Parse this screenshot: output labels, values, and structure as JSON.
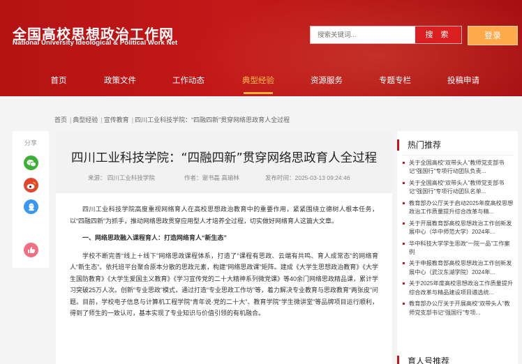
{
  "site": {
    "logo_cn": "全国高校思想政治工作网",
    "logo_en": "National University Ideological & Political Work Net"
  },
  "search": {
    "placeholder": "搜索关键词...",
    "button": "搜 索"
  },
  "login": "登录",
  "nav": [
    "首页",
    "政策文件",
    "工作动态",
    "典型经验",
    "资源服务",
    "专题专栏",
    "投稿申请"
  ],
  "nav_active": "典型经验",
  "breadcrumb": [
    "首页",
    "典型经验",
    "宣传教育",
    "四川工业科技学院：“四融四新”贯穿网络思政育人全过程"
  ],
  "share": {
    "label": "分享",
    "icons": [
      "wechat-icon",
      "weibo-icon",
      "qq-icon",
      "like-icon"
    ]
  },
  "colors": {
    "brand": "#c31818",
    "accent": "#ffb340",
    "wechat": "#3cb034",
    "weibo": "#e2472b",
    "qq": "#3a97f2",
    "like": "#f07082"
  },
  "article": {
    "title": "四川工业科技学院：“四融四新”贯穿网络思政育人全过程",
    "source": "来源： 四川工业科技学院",
    "author": "作者：谢书磊 高瑜林",
    "published": "发布时间：2025-03-13 09:24:46",
    "paragraphs": [
      "四川工业科技学院高度重视网络育人在高校思想政治教育中的重要作用，紧紧围绕立德树人根本任务，以“四融四新”为抓手，推动网络思政贯穿应用型人才培养全过程，切实做好网络育人这篇大文章。",
      "一、网络思政融入课程育人：打造网络育人“新生态”",
      "学校不断完善“线上＋线下”网络思政课程体系，打造了“课程有思政、云端有共鸣、育人成常态”的网络育人“新生态”。依托班平台聚合原本分散的思政元素，构建“网络思政课”矩阵。建成《大学生思想政治教育》《大学生国防教育》《大学生爱国主义教育》《学习宣传党的二十大精神系列微党课》等40余门网络思政精品课，累计学习突破25万人次。创新“专业思政”模式，通过打造“专业思政工作坊”等，着力解决专业教育与思政教育“两张皮”问题。目前，学校电子信息与计算机工程学院“青年说·党的二十大”、教育学院“学生微讲堂”等品牌项目运行顺利，得到了师生的一致认可，基本实现了专业知识与价值引领的有机融合。"
    ]
  },
  "sidebar": {
    "hot_title": "热门推荐",
    "hot_items": [
      "关于全国高校“双带头人”教师党支部书记“强国行”专项行动团队负责...",
      "关于全国高校“双带头人”教师党支部书记“强国行”专项行动团队名单...",
      "教育部办公厅关于启动2025年度高校思想政治工作质量提升综合改革与精...",
      "关于开展教育部高校思想政治工作创新发展中心（华中师范大学）2024年...",
      "华中科技大学学生思政“一院一品”工作案例",
      "关于申报教育部高校思想政治工作创新发展中心（武汉东湖学院）2024年...",
      "关于2025年度高校思想政治工作质量提升综合改革与精品建设项目遴选统...",
      "教育部办公厅关于开展高校“双带头人”教师党支部书记“强国行”专项..."
    ],
    "next_title": "育人号推荐"
  }
}
